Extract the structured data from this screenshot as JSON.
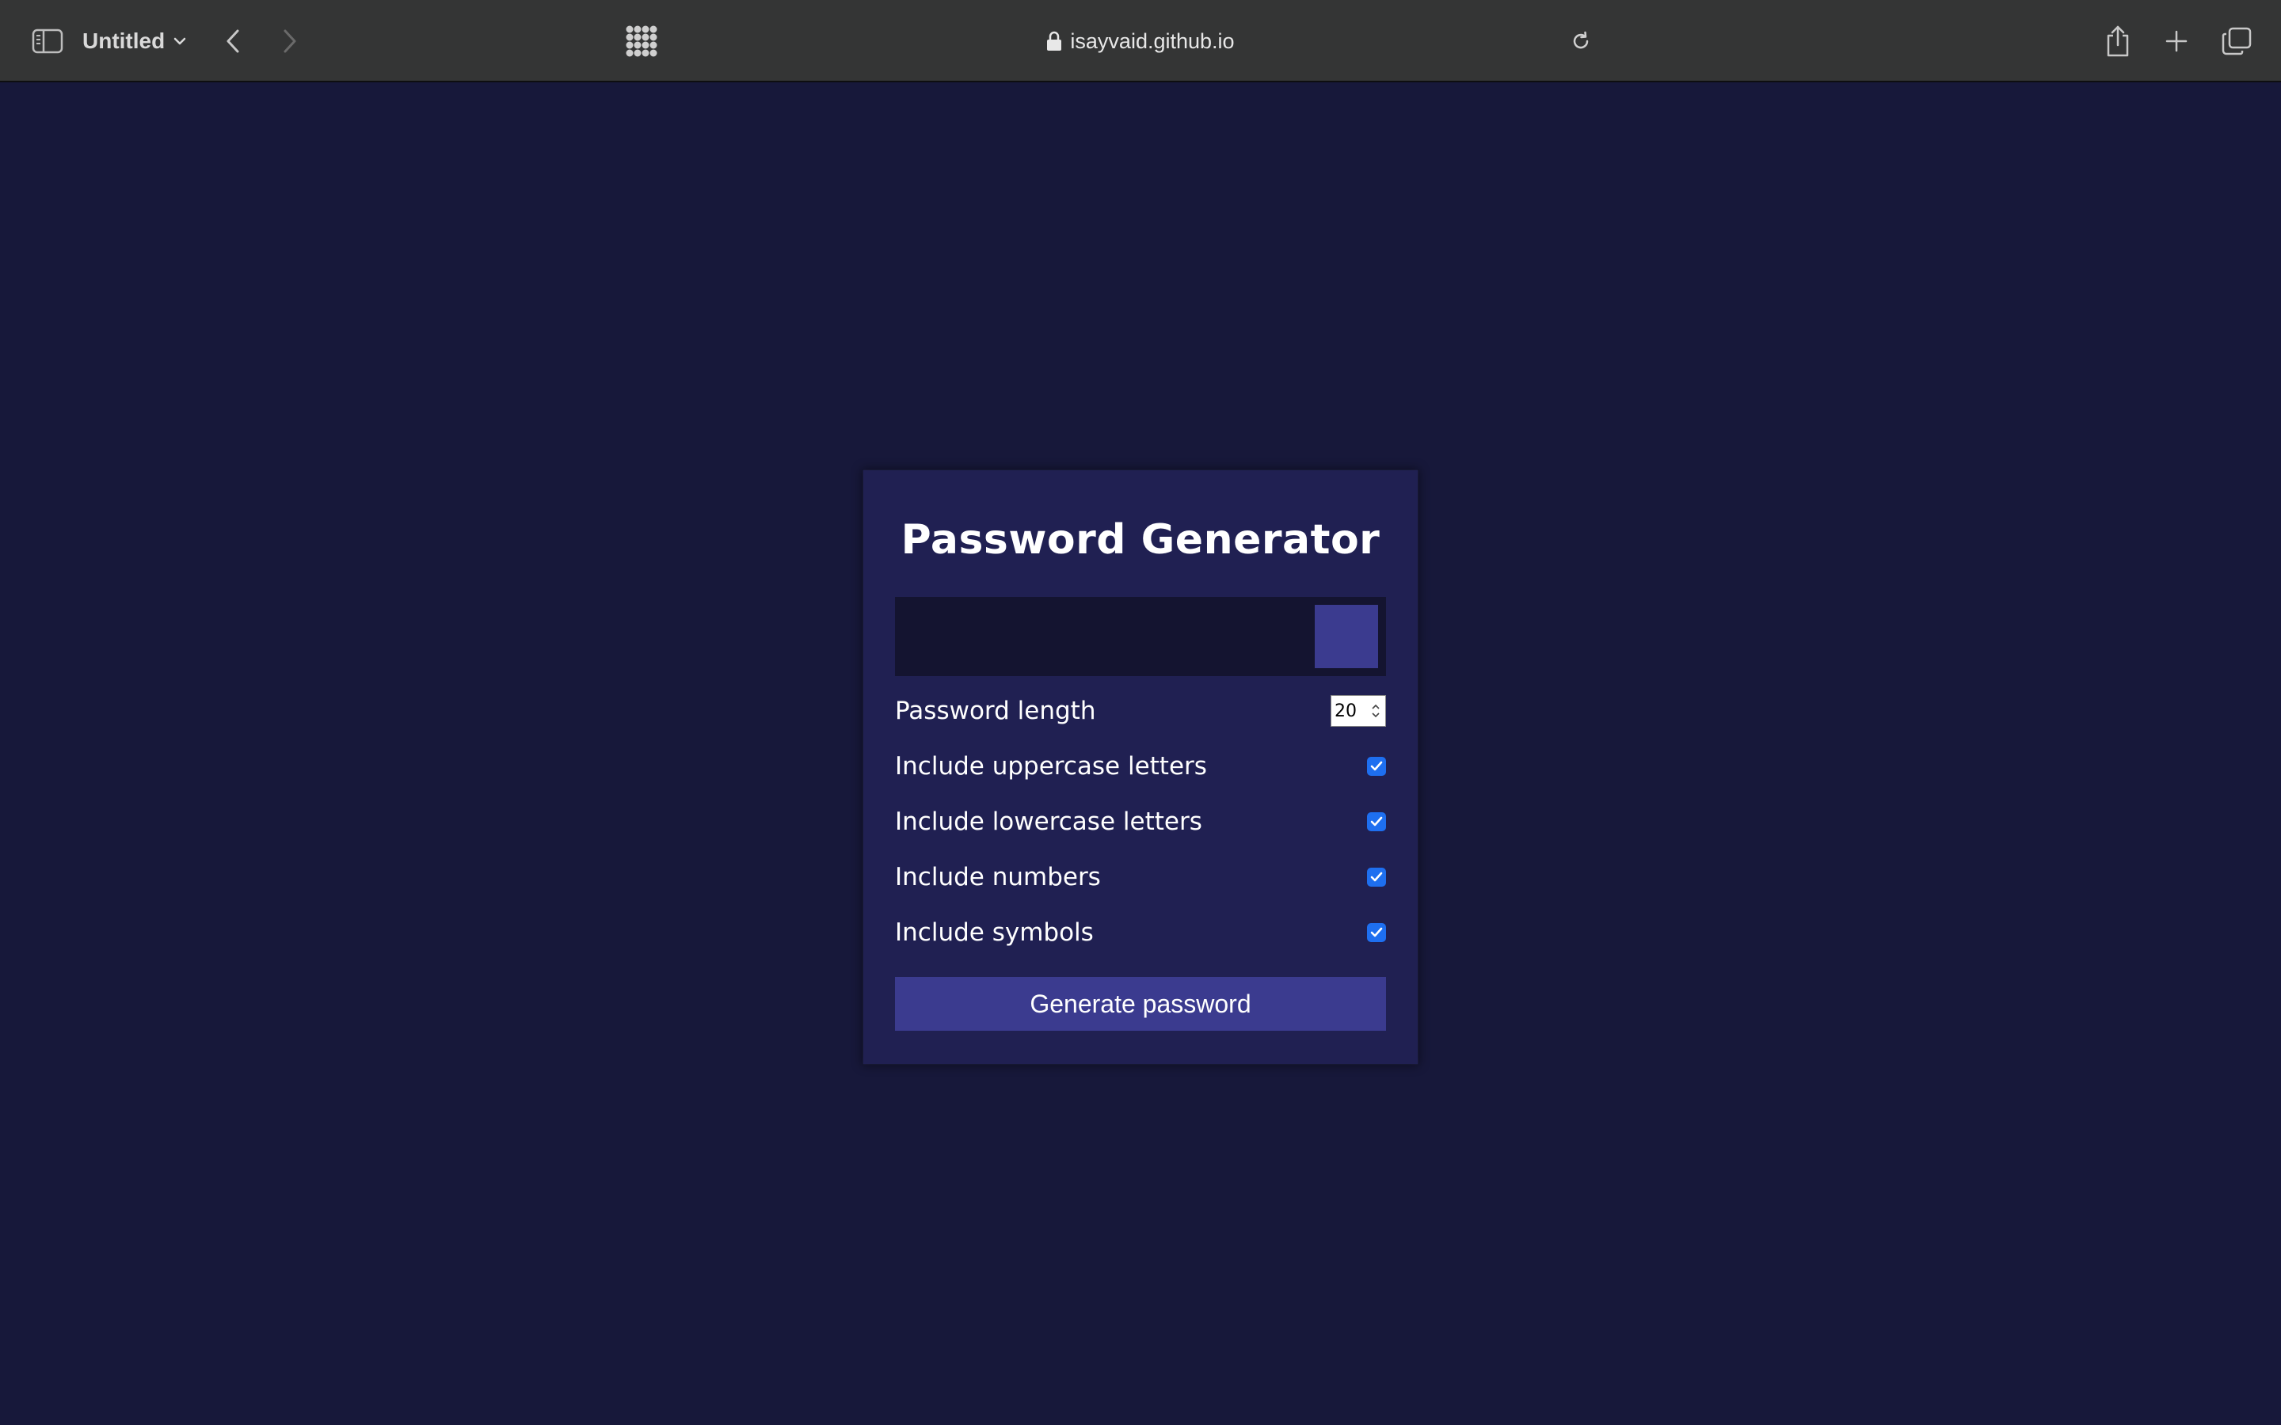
{
  "browser": {
    "tab_title": "Untitled",
    "address": "isayvaid.github.io",
    "icons": {
      "sidebar": "sidebar-icon",
      "back": "chevron-left-icon",
      "forward": "chevron-right-icon",
      "grid": "grid-dots-icon",
      "lock": "lock-icon",
      "reload": "reload-icon",
      "share": "share-icon",
      "new_tab": "plus-icon",
      "tabs_overview": "tabs-overview-icon"
    }
  },
  "app": {
    "title": "Password Generator",
    "result_value": "",
    "copy_icon": "copy-icon",
    "options": [
      {
        "label": "Password length",
        "type": "number",
        "value": "20"
      },
      {
        "label": "Include uppercase letters",
        "type": "checkbox",
        "checked": true
      },
      {
        "label": "Include lowercase letters",
        "type": "checkbox",
        "checked": true
      },
      {
        "label": "Include numbers",
        "type": "checkbox",
        "checked": true
      },
      {
        "label": "Include symbols",
        "type": "checkbox",
        "checked": true
      }
    ],
    "generate_label": "Generate password"
  },
  "colors": {
    "page_bg": "#17183a",
    "card_bg": "#202052",
    "result_bg": "#141430",
    "accent": "#3b3b8f",
    "checkbox": "#1e6ff0",
    "toolbar_bg": "#343535"
  }
}
